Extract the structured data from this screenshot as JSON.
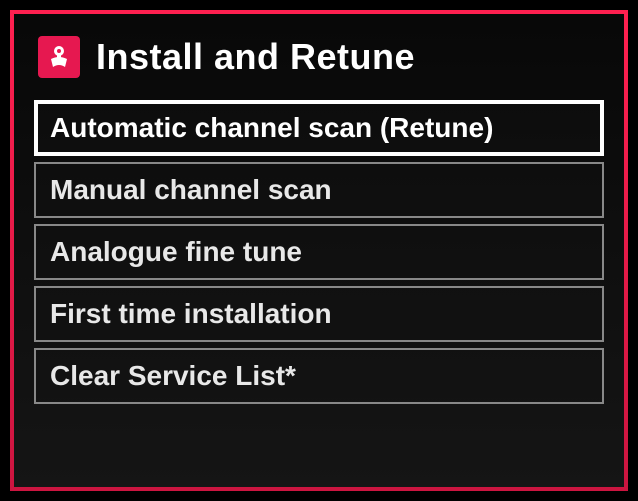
{
  "header": {
    "title": "Install and Retune",
    "icon": "satellite-dish-icon"
  },
  "menu": {
    "items": [
      {
        "label": "Automatic channel scan (Retune)",
        "selected": true
      },
      {
        "label": "Manual channel scan",
        "selected": false
      },
      {
        "label": "Analogue fine tune",
        "selected": false
      },
      {
        "label": "First time installation",
        "selected": false
      },
      {
        "label": "Clear Service List*",
        "selected": false
      }
    ]
  }
}
